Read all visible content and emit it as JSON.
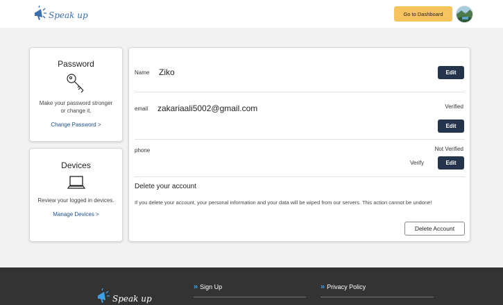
{
  "header": {
    "logo_text": "Speak up",
    "dashboard_button": "Go to Dashboard"
  },
  "password_card": {
    "title": "Password",
    "description": "Make your password stronger or change it.",
    "link": "Change Password >"
  },
  "devices_card": {
    "title": "Devices",
    "description": "Review your logged in devices.",
    "link": "Manage Devices >"
  },
  "account": {
    "name": {
      "label": "Name",
      "value": "Ziko",
      "edit": "Edit"
    },
    "email": {
      "label": "email",
      "value": "zakariaali5002@gmail.com",
      "status": "Verified",
      "edit": "Edit"
    },
    "phone": {
      "label": "phone",
      "value": "",
      "status": "Not Verified",
      "verify": "Verify",
      "edit": "Edit"
    },
    "delete": {
      "title": "Delete your account",
      "description": "If you delete your account, your personal information and your data will be wiped from our servers. This action cannot be undone!",
      "button": "Delete Account"
    }
  },
  "footer": {
    "logo_text": "Speak up",
    "links": [
      "Sign Up",
      "Privacy Policy"
    ]
  },
  "colors": {
    "accent_yellow": "#f7c35f",
    "navy": "#24344d",
    "link_blue": "#1f4e8c",
    "footer_bg": "#333333",
    "footer_accent": "#3fa0e6"
  }
}
